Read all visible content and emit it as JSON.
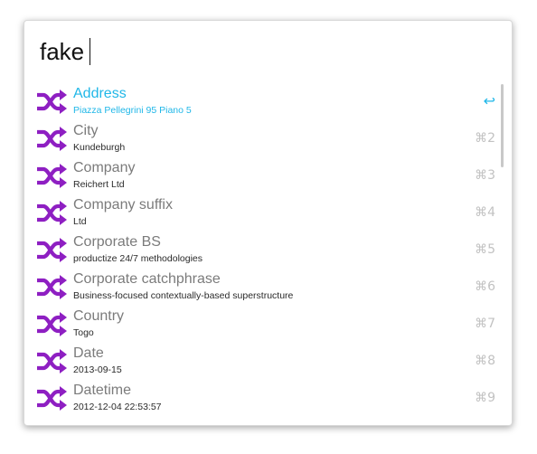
{
  "search": {
    "query": "fake"
  },
  "colors": {
    "selected": "#20b7e8",
    "icon": "#8e1fc2",
    "title": "#7b7b7b",
    "subtitle": "#2a2a2a",
    "shortcut": "#c2c2c2"
  },
  "results": [
    {
      "title": "Address",
      "subtitle": "Piazza Pellegrini 95 Piano 5",
      "shortcut": "↩",
      "icon": "shuffle-icon",
      "selected": true
    },
    {
      "title": "City",
      "subtitle": "Kundeburgh",
      "shortcut": "⌘2",
      "icon": "shuffle-icon",
      "selected": false
    },
    {
      "title": "Company",
      "subtitle": "Reichert Ltd",
      "shortcut": "⌘3",
      "icon": "shuffle-icon",
      "selected": false
    },
    {
      "title": "Company suffix",
      "subtitle": "Ltd",
      "shortcut": "⌘4",
      "icon": "shuffle-icon",
      "selected": false
    },
    {
      "title": "Corporate BS",
      "subtitle": "productize 24/7 methodologies",
      "shortcut": "⌘5",
      "icon": "shuffle-icon",
      "selected": false
    },
    {
      "title": "Corporate catchphrase",
      "subtitle": "Business-focused contextually-based superstructure",
      "shortcut": "⌘6",
      "icon": "shuffle-icon",
      "selected": false
    },
    {
      "title": "Country",
      "subtitle": "Togo",
      "shortcut": "⌘7",
      "icon": "shuffle-icon",
      "selected": false
    },
    {
      "title": "Date",
      "subtitle": "2013-09-15",
      "shortcut": "⌘8",
      "icon": "shuffle-icon",
      "selected": false
    },
    {
      "title": "Datetime",
      "subtitle": "2012-12-04 22:53:57",
      "shortcut": "⌘9",
      "icon": "shuffle-icon",
      "selected": false
    }
  ]
}
